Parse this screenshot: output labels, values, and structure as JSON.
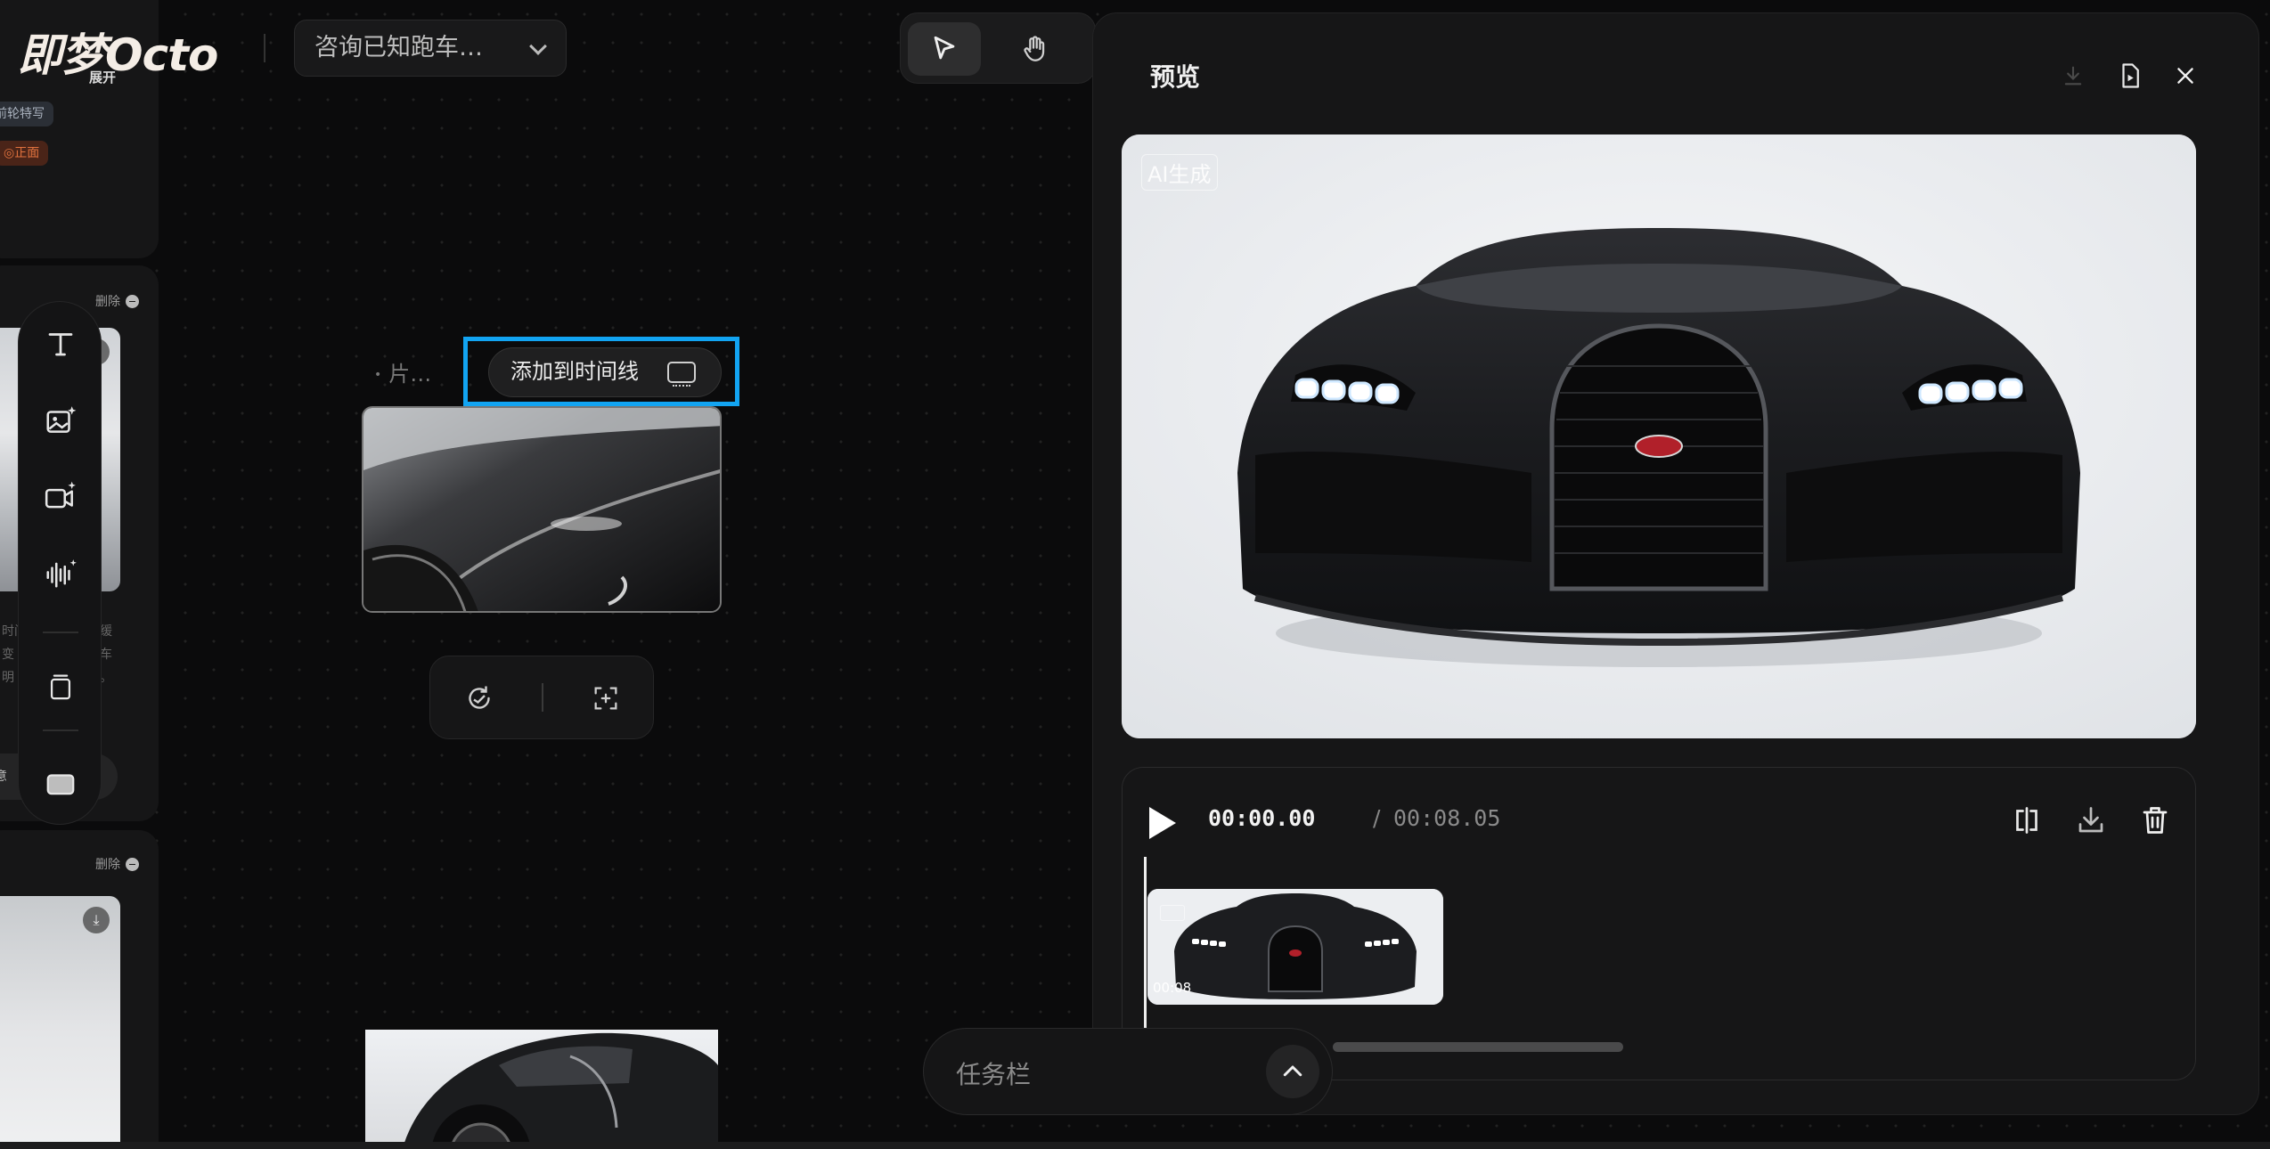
{
  "app": {
    "logo_text": "即梦Octo",
    "project_title": "咨询已知跑车…"
  },
  "left_panel": {
    "expand_label": "展开",
    "tags": [
      "后前轮特写",
      "◎正面"
    ],
    "delete_label": "删除",
    "card_text_lines": [
      "时间",
      "变",
      "明"
    ],
    "card_text_right": [
      "缓",
      "车",
      "。"
    ],
    "card_button_label": "刻意"
  },
  "canvas": {
    "node_title": "片…",
    "add_to_timeline_label": "添加到时间线"
  },
  "preview": {
    "title": "预览",
    "ai_badge": "AI生成",
    "time_current": "00:00.00",
    "time_separator": "/",
    "time_total": "00:08.05",
    "clip_duration": "00:08"
  },
  "taskbar": {
    "label": "任务栏"
  },
  "colors": {
    "highlight": "#12a4f2",
    "background": "#0b0b0c",
    "panel": "#161617"
  },
  "icons": {
    "select_tool": "cursor-arrow-icon",
    "hand_tool": "hand-icon",
    "text_tool": "text-T-icon",
    "image_gen": "image-sparkle-icon",
    "video_gen": "video-sparkle-icon",
    "audio_gen": "audio-wave-icon",
    "stack": "stack-icon",
    "frame": "frame-icon"
  }
}
